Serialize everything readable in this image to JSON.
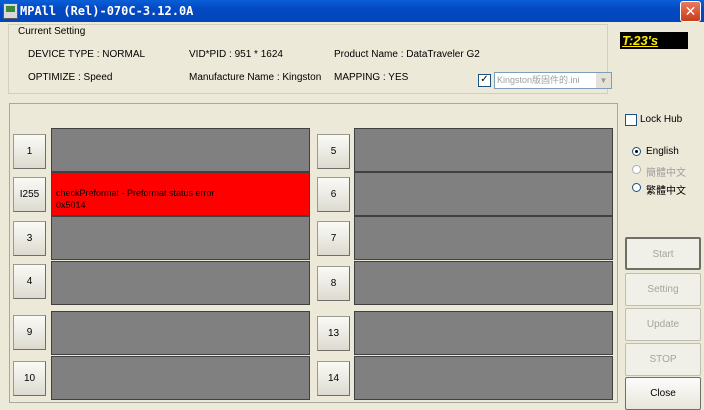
{
  "window": {
    "title": "MPAll (Rel)-070C-3.12.0A",
    "close_glyph": "✕"
  },
  "current_setting": {
    "legend": "Current Setting",
    "device_type": "DEVICE TYPE : NORMAL",
    "vid_pid": "VID*PID :  951 * 1624",
    "product_name": "Product Name : DataTraveler G2",
    "optimize": "OPTIMIZE : Speed",
    "manufacture_name": "Manufacture Name : Kingston",
    "mapping": "MAPPING : YES",
    "ini_checked": true,
    "ini_check_glyph": "✓",
    "ini_file": "Kingston版固件的.ini",
    "ini_arrow": "▼"
  },
  "timer": "T:23's",
  "ports": [
    {
      "label": "1",
      "status": "",
      "detail": "",
      "state": "idle"
    },
    {
      "label": "I255",
      "status": "checkPreformat - Preformat status error",
      "detail": "0x5014",
      "state": "error"
    },
    {
      "label": "3",
      "status": "",
      "detail": "",
      "state": "idle"
    },
    {
      "label": "4",
      "status": "",
      "detail": "",
      "state": "idle"
    },
    {
      "label": "9",
      "status": "",
      "detail": "",
      "state": "idle"
    },
    {
      "label": "10",
      "status": "",
      "detail": "",
      "state": "idle"
    },
    {
      "label": "5",
      "status": "",
      "detail": "",
      "state": "idle"
    },
    {
      "label": "6",
      "status": "",
      "detail": "",
      "state": "idle"
    },
    {
      "label": "7",
      "status": "",
      "detail": "",
      "state": "idle"
    },
    {
      "label": "8",
      "status": "",
      "detail": "",
      "state": "idle"
    },
    {
      "label": "13",
      "status": "",
      "detail": "",
      "state": "idle"
    },
    {
      "label": "14",
      "status": "",
      "detail": "",
      "state": "idle"
    }
  ],
  "side": {
    "lock_hub": "Lock Hub",
    "languages": [
      {
        "label": "English",
        "selected": true,
        "enabled": true
      },
      {
        "label": "簡體中文",
        "selected": false,
        "enabled": false
      },
      {
        "label": "繁體中文",
        "selected": false,
        "enabled": true
      }
    ]
  },
  "actions": [
    {
      "label": "Start",
      "enabled": false
    },
    {
      "label": "Setting",
      "enabled": false
    },
    {
      "label": "Update",
      "enabled": false
    },
    {
      "label": "STOP",
      "enabled": false
    },
    {
      "label": "Close",
      "enabled": true
    }
  ],
  "colors": {
    "error_bar": "#ff0000",
    "idle_bar": "#808080",
    "timer_text": "#ffeb00"
  }
}
